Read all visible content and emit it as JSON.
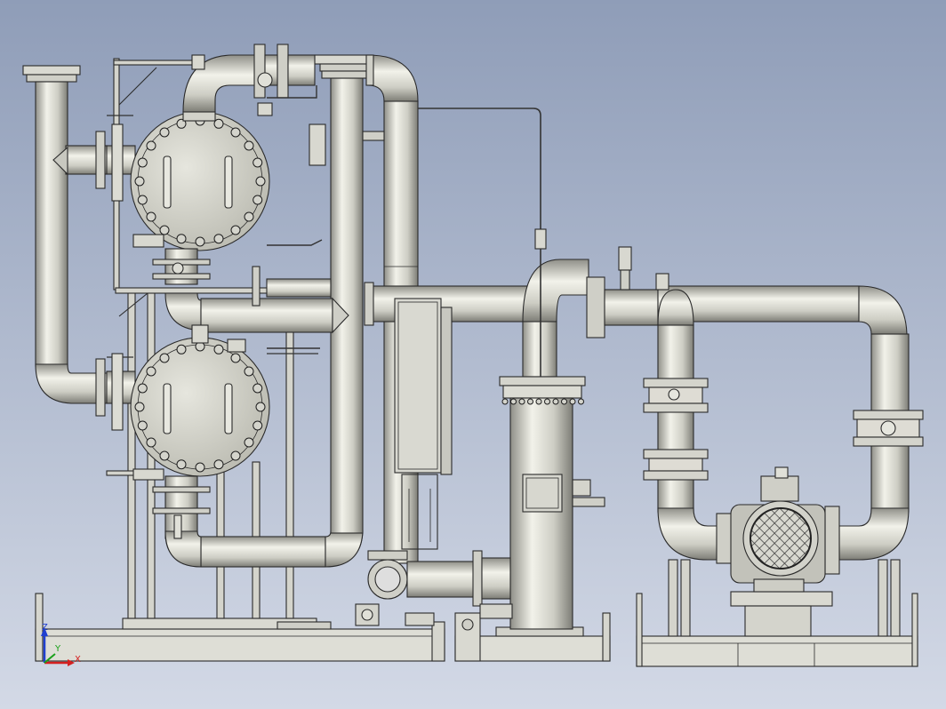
{
  "colors": {
    "background_top": "#8f9db8",
    "background_bottom": "#d3d9e6",
    "metal_light": "#e8e8e0",
    "metal_mid": "#cfcfc6",
    "metal_dark": "#9c9c94",
    "outline": "#2a2a2a",
    "axis_x": "#d42020",
    "axis_y": "#1aa01a",
    "axis_z": "#2040d0"
  },
  "triad": {
    "x_label": "X",
    "y_label": "Y",
    "z_label": "Z"
  }
}
